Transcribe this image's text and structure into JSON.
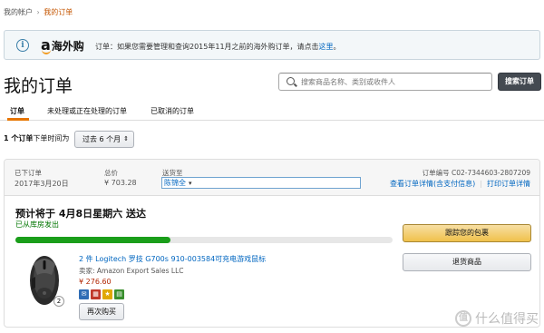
{
  "breadcrumb": {
    "account": "我的帐户",
    "separator": "›",
    "current": "我的订单"
  },
  "notice": {
    "info_icon": "i",
    "brand_letter": "a",
    "brand_text": "海外购",
    "message": "订单：如果您需要管理和查询2015年11月之前的海外购订单，请点击",
    "link": "这里",
    "suffix": "。"
  },
  "page_title": "我的订单",
  "search": {
    "placeholder": "搜索商品名称、类别或收件人",
    "button_label": "搜索订单"
  },
  "tabs": [
    {
      "label": "订单",
      "active": true
    },
    {
      "label": "未处理或正在处理的订单",
      "active": false
    },
    {
      "label": "已取消的订单",
      "active": false
    }
  ],
  "filter": {
    "count": "1 个订单",
    "text": "下单时间为",
    "period": "过去 6 个月"
  },
  "order": {
    "placed_label": "已下订单",
    "placed_date": "2017年3月20日",
    "total_label": "总价",
    "total_value": "¥ 703.28",
    "ship_to_label": "送货至",
    "ship_to_value": "陈锦全",
    "order_number": "订单编号 C02-7344603-2807209",
    "details_link": "查看订单详情(含支付信息)",
    "invoice_link": "打印订单详情",
    "delivery_title": "预计将于 4月8日星期六 送达",
    "delivery_status": "已从库房发出",
    "progress_fraction": 0.41,
    "track_button": "跟踪您的包裹",
    "return_button": "退货商品",
    "product": {
      "title": "2 件 Logitech 罗技 G700s 910-003584可充电游戏鼠标",
      "seller": "卖家: Amazon Export Sales LLC",
      "price": "¥ 276.60",
      "quantity": "2",
      "buy_again": "再次购买"
    }
  },
  "watermark": {
    "logo": "值",
    "text": "什么值得买"
  },
  "colors": {
    "accent": "#e77600",
    "link": "#0066c0",
    "price": "#b12704",
    "success": "#007600",
    "progress": "#1a9e1a",
    "primary_button": "#f0c14b"
  }
}
